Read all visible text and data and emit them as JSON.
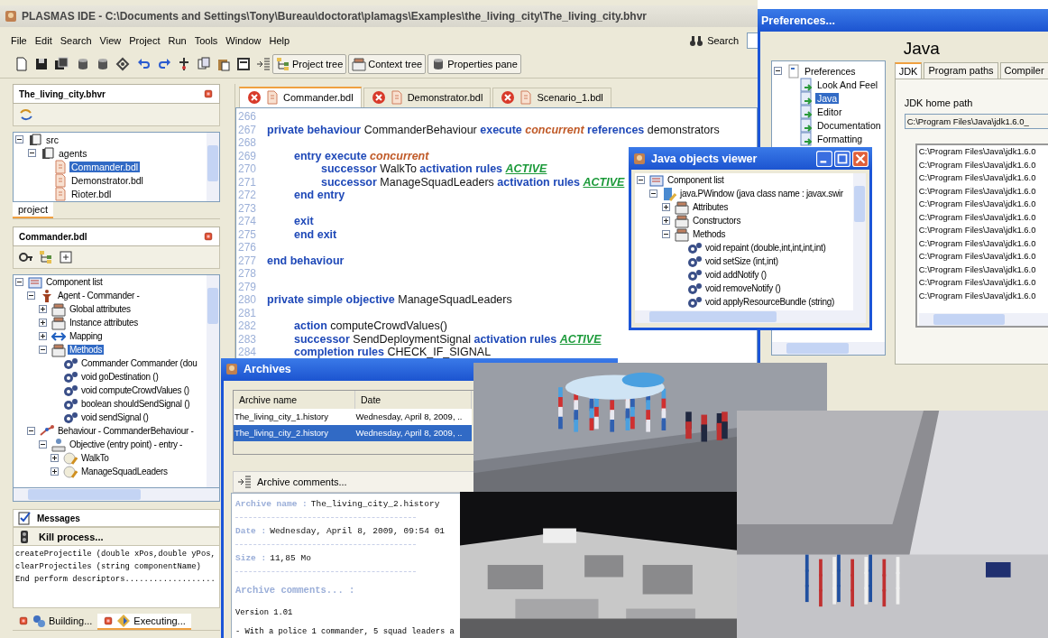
{
  "main_window": {
    "title": "PLASMAS IDE - C:\\Documents and Settings\\Tony\\Bureau\\doctorat\\plamags\\Examples\\the_living_city\\The_living_city.bhvr",
    "menu": [
      "File",
      "Edit",
      "Search",
      "View",
      "Project",
      "Run",
      "Tools",
      "Window",
      "Help"
    ],
    "search_button": "Search",
    "toolbar_buttons": [
      "Project tree",
      "Context tree",
      "Properties pane"
    ]
  },
  "project_panel": {
    "title": "The_living_city.bhvr",
    "tree": [
      {
        "label": "src",
        "kind": "binder",
        "expanded": true,
        "selected": false,
        "children": [
          {
            "label": "agents",
            "kind": "binder",
            "expanded": true,
            "selected": false,
            "children": [
              {
                "label": "Commander.bdl",
                "kind": "file",
                "selected": true
              },
              {
                "label": "Demonstrator.bdl",
                "kind": "file",
                "selected": false
              },
              {
                "label": "Rioter.bdl",
                "kind": "file",
                "selected": false
              }
            ]
          }
        ]
      }
    ],
    "tabs": [
      {
        "label": "project",
        "selected": true
      }
    ]
  },
  "outline_panel": {
    "title": "Commander.bdl",
    "tree": [
      {
        "label": "Component list",
        "kind": "list",
        "expanded": true,
        "selected": false,
        "children": [
          {
            "label": "Agent - Commander -",
            "kind": "agent",
            "expanded": true,
            "selected": false,
            "children": [
              {
                "label": "Global attributes",
                "kind": "drawer",
                "expanded": false,
                "selected": false
              },
              {
                "label": "Instance attributes",
                "kind": "drawer",
                "expanded": false,
                "selected": false
              },
              {
                "label": "Mapping",
                "kind": "mapping",
                "expanded": false,
                "selected": false
              },
              {
                "label": "Methods",
                "kind": "drawer",
                "expanded": true,
                "selected": true,
                "children": [
                  {
                    "label": "Commander Commander (dou",
                    "kind": "method",
                    "selected": false
                  },
                  {
                    "label": "void goDestination ()",
                    "kind": "method",
                    "selected": false
                  },
                  {
                    "label": "void computeCrowdValues ()",
                    "kind": "method",
                    "selected": false
                  },
                  {
                    "label": "boolean shouldSendSignal ()",
                    "kind": "method",
                    "selected": false
                  },
                  {
                    "label": "void sendSignal ()",
                    "kind": "method",
                    "selected": false
                  }
                ]
              }
            ]
          },
          {
            "label": "Behaviour - CommanderBehaviour -",
            "kind": "behaviour",
            "expanded": true,
            "selected": false,
            "children": [
              {
                "label": "Objective (entry point) - entry -",
                "kind": "objective",
                "expanded": true,
                "selected": false,
                "children": [
                  {
                    "label": "WalkTo",
                    "kind": "task",
                    "expanded": false,
                    "selected": false
                  },
                  {
                    "label": "ManageSquadLeaders",
                    "kind": "task",
                    "expanded": false,
                    "selected": false
                  }
                ]
              }
            ]
          }
        ]
      }
    ]
  },
  "messages_panel": {
    "title": "Messages",
    "kill_button": "Kill process...",
    "lines": [
      "createProjectile (double xPos,double yPos,",
      "clearProjectiles (string componentName)",
      "End perform descriptors..................."
    ],
    "tabs": [
      {
        "label": "Building...",
        "selected": false
      },
      {
        "label": "Executing...",
        "selected": true
      }
    ]
  },
  "editor": {
    "tabs": [
      {
        "label": "Commander.bdl",
        "selected": true
      },
      {
        "label": "Demonstrator.bdl",
        "selected": false
      },
      {
        "label": "Scenario_1.bdl",
        "selected": false
      }
    ],
    "lines": [
      {
        "number": "266"
      },
      {
        "number": "267",
        "tokens": [
          {
            "kind": "keyword",
            "text": "private behaviour"
          },
          {
            "kind": "name",
            "text": "CommanderBehaviour"
          },
          {
            "kind": "keyword",
            "text": "execute"
          },
          {
            "kind": "mode",
            "text": "concurrent"
          },
          {
            "kind": "keyword",
            "text": "references"
          },
          {
            "kind": "name",
            "text": "demonstrators"
          }
        ],
        "children": [
          {
            "number": "268"
          },
          {
            "number": "269",
            "tokens": [
              {
                "kind": "keyword",
                "text": "entry execute"
              },
              {
                "kind": "mode",
                "text": "concurrent"
              }
            ],
            "children": [
              {
                "number": "270",
                "tokens": [
                  {
                    "kind": "keyword",
                    "text": "successor"
                  },
                  {
                    "kind": "name",
                    "text": "WalkTo"
                  },
                  {
                    "kind": "keyword",
                    "text": "activation rules"
                  },
                  {
                    "kind": "rule",
                    "text": "ACTIVE"
                  }
                ]
              },
              {
                "number": "271",
                "tokens": [
                  {
                    "kind": "keyword",
                    "text": "successor"
                  },
                  {
                    "kind": "name",
                    "text": "ManageSquadLeaders"
                  },
                  {
                    "kind": "keyword",
                    "text": "activation rules"
                  },
                  {
                    "kind": "rule",
                    "text": "ACTIVE"
                  }
                ]
              }
            ]
          },
          {
            "number": "272",
            "tokens": [
              {
                "kind": "keyword",
                "text": "end entry"
              }
            ]
          },
          {
            "number": "273"
          },
          {
            "number": "274",
            "tokens": [
              {
                "kind": "keyword",
                "text": "exit"
              }
            ]
          },
          {
            "number": "275",
            "tokens": [
              {
                "kind": "keyword",
                "text": "end exit"
              }
            ]
          },
          {
            "number": "276"
          }
        ]
      },
      {
        "number": "277",
        "tokens": [
          {
            "kind": "keyword",
            "text": "end behaviour"
          }
        ]
      },
      {
        "number": "278"
      },
      {
        "number": "279"
      },
      {
        "number": "280",
        "tokens": [
          {
            "kind": "keyword",
            "text": "private simple objective"
          },
          {
            "kind": "name",
            "text": "ManageSquadLeaders"
          }
        ],
        "children": [
          {
            "number": "281"
          },
          {
            "number": "282",
            "tokens": [
              {
                "kind": "keyword",
                "text": "action"
              },
              {
                "kind": "name",
                "text": "computeCrowdValues()"
              }
            ]
          },
          {
            "number": "283",
            "tokens": [
              {
                "kind": "keyword",
                "text": "successor"
              },
              {
                "kind": "name",
                "text": "SendDeploymentSignal"
              },
              {
                "kind": "keyword",
                "text": "activation rules"
              },
              {
                "kind": "rule",
                "text": "ACTIVE"
              }
            ]
          },
          {
            "number": "284",
            "tokens": [
              {
                "kind": "keyword",
                "text": "completion rules"
              },
              {
                "kind": "name",
                "text": "CHECK_IF_SIGNAL"
              }
            ]
          }
        ]
      }
    ]
  },
  "java_viewer": {
    "title": "Java objects viewer",
    "tree": [
      {
        "label": "Component list",
        "kind": "list",
        "expanded": true,
        "selected": false,
        "children": [
          {
            "label": "java.PWindow (java class name : javax.swir",
            "kind": "class",
            "expanded": true,
            "selected": false,
            "children": [
              {
                "label": "Attributes",
                "kind": "drawer",
                "expanded": false,
                "selected": false
              },
              {
                "label": "Constructors",
                "kind": "drawer",
                "expanded": false,
                "selected": false
              },
              {
                "label": "Methods",
                "kind": "drawer",
                "expanded": true,
                "selected": false,
                "children": [
                  {
                    "label": "void repaint (double,int,int,int,int)",
                    "kind": "method",
                    "selected": false
                  },
                  {
                    "label": "void setSize (int,int)",
                    "kind": "method",
                    "selected": false
                  },
                  {
                    "label": "void addNotify ()",
                    "kind": "method",
                    "selected": false
                  },
                  {
                    "label": "void removeNotify ()",
                    "kind": "method",
                    "selected": false
                  },
                  {
                    "label": "void applyResourceBundle (string)",
                    "kind": "method",
                    "selected": false
                  }
                ]
              }
            ]
          }
        ]
      }
    ]
  },
  "preferences": {
    "title": "Preferences...",
    "tree": [
      {
        "label": "Preferences",
        "kind": "page",
        "expanded": true,
        "selected": false,
        "children": [
          {
            "label": "Look And Feel",
            "kind": "prefpage",
            "selected": false
          },
          {
            "label": "Java",
            "kind": "prefpage",
            "selected": true
          },
          {
            "label": "Editor",
            "kind": "prefpage",
            "selected": false
          },
          {
            "label": "Documentation",
            "kind": "prefpage",
            "selected": false
          },
          {
            "label": "Formatting",
            "kind": "prefpage",
            "selected": false
          }
        ]
      }
    ],
    "heading": "Java",
    "tabs": [
      {
        "label": "JDK",
        "selected": true
      },
      {
        "label": "Program paths",
        "selected": false
      },
      {
        "label": "Compiler",
        "selected": false
      }
    ],
    "path_label": "JDK home path",
    "path_value": "C:\\Program Files\\Java\\jdk1.6.0_",
    "paths": [
      "C:\\Program Files\\Java\\jdk1.6.0",
      "C:\\Program Files\\Java\\jdk1.6.0",
      "C:\\Program Files\\Java\\jdk1.6.0",
      "C:\\Program Files\\Java\\jdk1.6.0",
      "C:\\Program Files\\Java\\jdk1.6.0",
      "C:\\Program Files\\Java\\jdk1.6.0",
      "C:\\Program Files\\Java\\jdk1.6.0",
      "C:\\Program Files\\Java\\jdk1.6.0",
      "C:\\Program Files\\Java\\jdk1.6.0",
      "C:\\Program Files\\Java\\jdk1.6.0",
      "C:\\Program Files\\Java\\jdk1.6.0",
      "C:\\Program Files\\Java\\jdk1.6.0"
    ]
  },
  "archives": {
    "title": "Archives",
    "columns": [
      "Archive name",
      "Date"
    ],
    "rows": [
      {
        "cells": [
          "The_living_city_1.history",
          "Wednesday, April 8, 2009, .."
        ],
        "selected": false
      },
      {
        "cells": [
          "The_living_city_2.history",
          "Wednesday, April 8, 2009, .."
        ],
        "selected": true
      }
    ],
    "comments_title": "Archive comments...",
    "fields": [
      {
        "label": "Archive name :",
        "value": "The_living_city_2.history"
      },
      {
        "label": "Date :",
        "value": "Wednesday, April 8, 2009, 09:54 01"
      },
      {
        "label": "Size :",
        "value": "11,85 Mo"
      }
    ],
    "comments_heading": "Archive comments... :",
    "comments": [
      "Version 1.01",
      "- With a police 1 commander, 5 squad leaders a"
    ]
  }
}
